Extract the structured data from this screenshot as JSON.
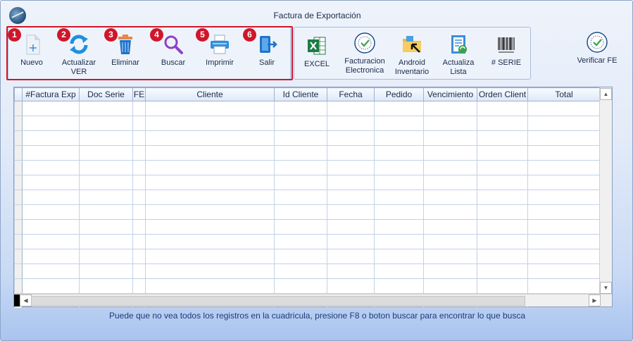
{
  "window": {
    "title": "Factura de Exportación"
  },
  "toolbar_main": [
    {
      "badge": "1",
      "label": "Nuevo",
      "icon": "new-document-icon"
    },
    {
      "badge": "2",
      "label": "Actualizar\nVER",
      "icon": "refresh-icon"
    },
    {
      "badge": "3",
      "label": "Eliminar",
      "icon": "trash-icon"
    },
    {
      "badge": "4",
      "label": "Buscar",
      "icon": "search-icon"
    },
    {
      "badge": "5",
      "label": "Imprimir",
      "icon": "printer-icon"
    },
    {
      "badge": "6",
      "label": "Salir",
      "icon": "exit-door-icon"
    }
  ],
  "toolbar_extra": [
    {
      "label": "EXCEL",
      "icon": "excel-icon"
    },
    {
      "label": "Facturacion\nElectronica",
      "icon": "e-invoice-seal-icon"
    },
    {
      "label": "Android\nInventario",
      "icon": "folder-arrow-icon"
    },
    {
      "label": "Actualiza\nLista",
      "icon": "list-refresh-icon"
    },
    {
      "label": "# SERIE",
      "icon": "barcode-icon"
    }
  ],
  "verify": {
    "label": "Verificar FE",
    "icon": "e-invoice-seal-icon"
  },
  "grid": {
    "columns": [
      "#Factura Exp",
      "Doc Serie",
      "FE",
      "Cliente",
      "Id Cliente",
      "Fecha",
      "Pedido",
      "Vencimiento",
      "Orden Client",
      "Total"
    ],
    "row_count": 14
  },
  "footer": {
    "message": "Puede que no vea todos los registros en la cuadricula, presione F8 o boton buscar para encontrar lo que busca"
  },
  "colors": {
    "badge": "#d0162a",
    "highlight_box": "#d0162a",
    "window_gradient_bottom": "#a9c4ef"
  }
}
